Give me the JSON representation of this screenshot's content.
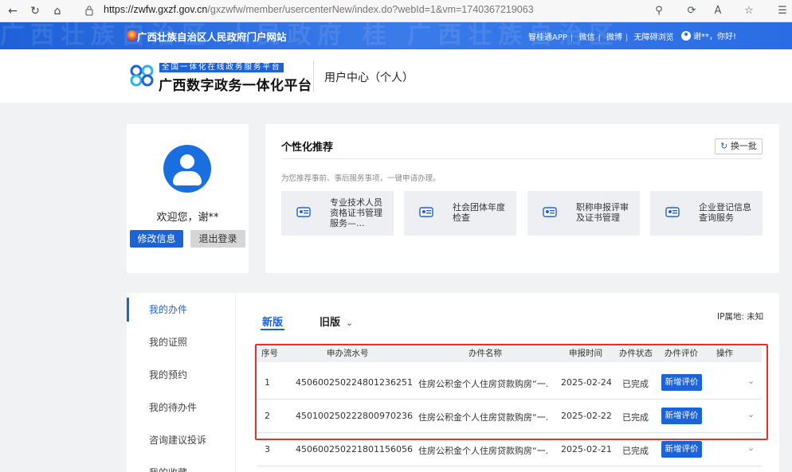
{
  "browser": {
    "url_host": "https://zwfw.gxzf.gov.cn",
    "url_path": "/gxzwfw/member/usercenterNew/index.do?webId=1&vm=1740367219063"
  },
  "gov_bar": {
    "title": "广西壮族自治区人民政府门户网站",
    "links": [
      "智桂通APP",
      "微信",
      "微博",
      "无障碍浏览"
    ],
    "greeting": "谢**，你好!",
    "pattern_text": "广西壮族自治区 人民政府 桂 广西壮族自治区"
  },
  "header": {
    "logo_tag": "全国一体化在线政务服务平台",
    "logo_name": "广西数字政务一体化平台",
    "subtitle": "用户中心（个人）"
  },
  "profile": {
    "welcome": "欢迎您，谢**",
    "edit_label": "修改信息",
    "logout_label": "退出登录"
  },
  "recommend": {
    "title": "个性化推荐",
    "refresh_label": "换一批",
    "description": "为您推荐事前、事后服务事项，一键申请办理。",
    "items": [
      {
        "label": "专业技术人员资格证书管理服务—..."
      },
      {
        "label": "社会团体年度检查"
      },
      {
        "label": "职称申报评审及证书管理"
      },
      {
        "label": "企业登记信息查询服务"
      }
    ]
  },
  "left_nav": {
    "items": [
      {
        "label": "我的办件",
        "active": true
      },
      {
        "label": "我的证照",
        "active": false
      },
      {
        "label": "我的预约",
        "active": false
      },
      {
        "label": "我的待办件",
        "active": false
      },
      {
        "label": "咨询建议投诉",
        "active": false
      },
      {
        "label": "我的收藏",
        "active": false
      }
    ]
  },
  "main": {
    "tab_new": "新版",
    "tab_old": "旧版",
    "ip_label": "IP属地: 未知",
    "columns": [
      "序号",
      "申办流水号",
      "办件名称",
      "申报时间",
      "办件状态",
      "办件评价",
      "操作"
    ],
    "rows": [
      {
        "no": "1",
        "serial": "450600250224801236251",
        "name": "住房公积金个人住房贷款购房“一...",
        "date": "2025-02-24",
        "status": "已完成",
        "action": "新增评价"
      },
      {
        "no": "2",
        "serial": "450100250222800970236",
        "name": "住房公积金个人住房贷款购房“一...",
        "date": "2025-02-22",
        "status": "已完成",
        "action": "新增评价"
      },
      {
        "no": "3",
        "serial": "450600250221801156056",
        "name": "住房公积金个人住房贷款购房“一...",
        "date": "2025-02-21",
        "status": "已完成",
        "action": "新增评价"
      }
    ]
  },
  "colors": {
    "accent": "#1d63d8",
    "highlight": "#e4322b",
    "page_bg": "#f1f2f4"
  }
}
